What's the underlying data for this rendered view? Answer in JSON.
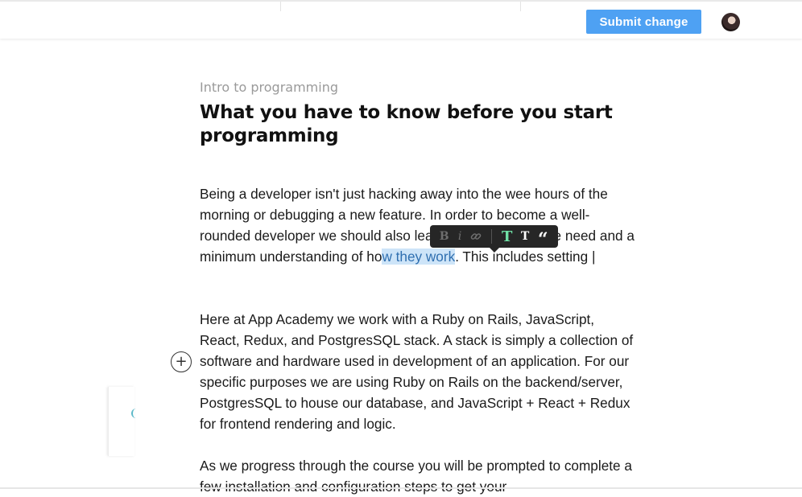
{
  "header": {
    "submit_label": "Submit change",
    "accent_color": "#4ea1f3"
  },
  "article": {
    "category": "Intro to programming",
    "title": "What you have to know before you start programming",
    "p1": {
      "before": "Being a developer isn't just hacking away into the wee hours of the morning or debugging a new feature. In order to become a well-rounded developer we should als",
      "hidden_under_toolbar": "o learn about the t",
      "after_toolbar": "ools we need and a minimum understanding of ho",
      "highlighted": "w they work",
      "after": ". This includes setting ",
      "caret": "|"
    },
    "p2": "Here at App Academy we work with a Ruby on Rails, JavaScript, React, Redux, and PostgresSQL stack. A stack is simply a collection of software and hardware used in development of an application. For our specific purposes we are using Ruby on Rails on the backend/server, PostgresSQL to house our database, and JavaScript + React + Redux for frontend rendering and logic.",
    "p3": "As we progress through the course you will be prompted to complete a few installation and configuration steps to get your"
  },
  "toolbar": {
    "bold": "B",
    "italic": "i",
    "link_icon": "link-icon",
    "big_heading": "T",
    "small_heading": "T",
    "quote": "“",
    "active_color": "#6fe0a5"
  },
  "insert_button": {
    "label": "+"
  }
}
